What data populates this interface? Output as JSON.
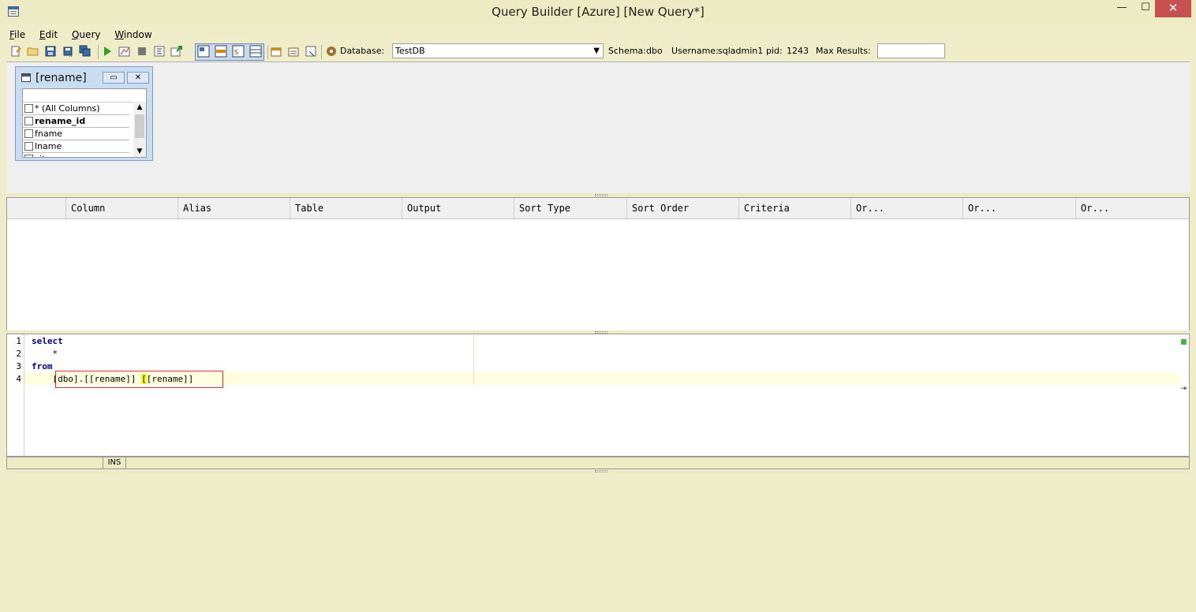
{
  "window": {
    "title": "Query Builder [Azure] [New Query*]",
    "close_glyph": "✕",
    "min_glyph": "—",
    "max_glyph": "☐"
  },
  "menu": [
    {
      "label": "File",
      "ul": "F",
      "rest": "ile"
    },
    {
      "label": "Edit",
      "ul": "E",
      "rest": "dit"
    },
    {
      "label": "Query",
      "ul": "Q",
      "rest": "uery"
    },
    {
      "label": "Window",
      "ul": "W",
      "rest": "indow"
    }
  ],
  "toolbar": {
    "database_label": "Database:",
    "database_value": "TestDB",
    "schema_label": "Schema:",
    "schema_value": "dbo",
    "username_label": "Username:",
    "username_value": "sqladmin1",
    "pid_label": "pid:",
    "pid_value": "1243",
    "max_results_label": "Max Results:",
    "max_results_value": ""
  },
  "table_box": {
    "title": "[rename]",
    "columns": [
      {
        "label": "* (All Columns)",
        "checked": false
      },
      {
        "label": "rename_id",
        "checked": false,
        "primary_key": true
      },
      {
        "label": "fname",
        "checked": false
      },
      {
        "label": "lname",
        "checked": false
      },
      {
        "label": "city",
        "checked": false
      }
    ]
  },
  "grid": {
    "headers": [
      "Column",
      "Alias",
      "Table",
      "Output",
      "Sort Type",
      "Sort Order",
      "Criteria",
      "Or...",
      "Or...",
      "Or..."
    ]
  },
  "editor": {
    "lines": [
      {
        "num": "1",
        "text": "select"
      },
      {
        "num": "2",
        "text": "    *"
      },
      {
        "num": "3",
        "text": "from"
      },
      {
        "num": "4",
        "pre": "    [dbo].[[rename]] ",
        "hl": "[",
        "post": "[rename]]"
      }
    ]
  },
  "status": {
    "mode": "INS"
  },
  "colors": {
    "accent": "#c75050",
    "keyword": "#00008b",
    "highlight_box": "#e03030"
  }
}
